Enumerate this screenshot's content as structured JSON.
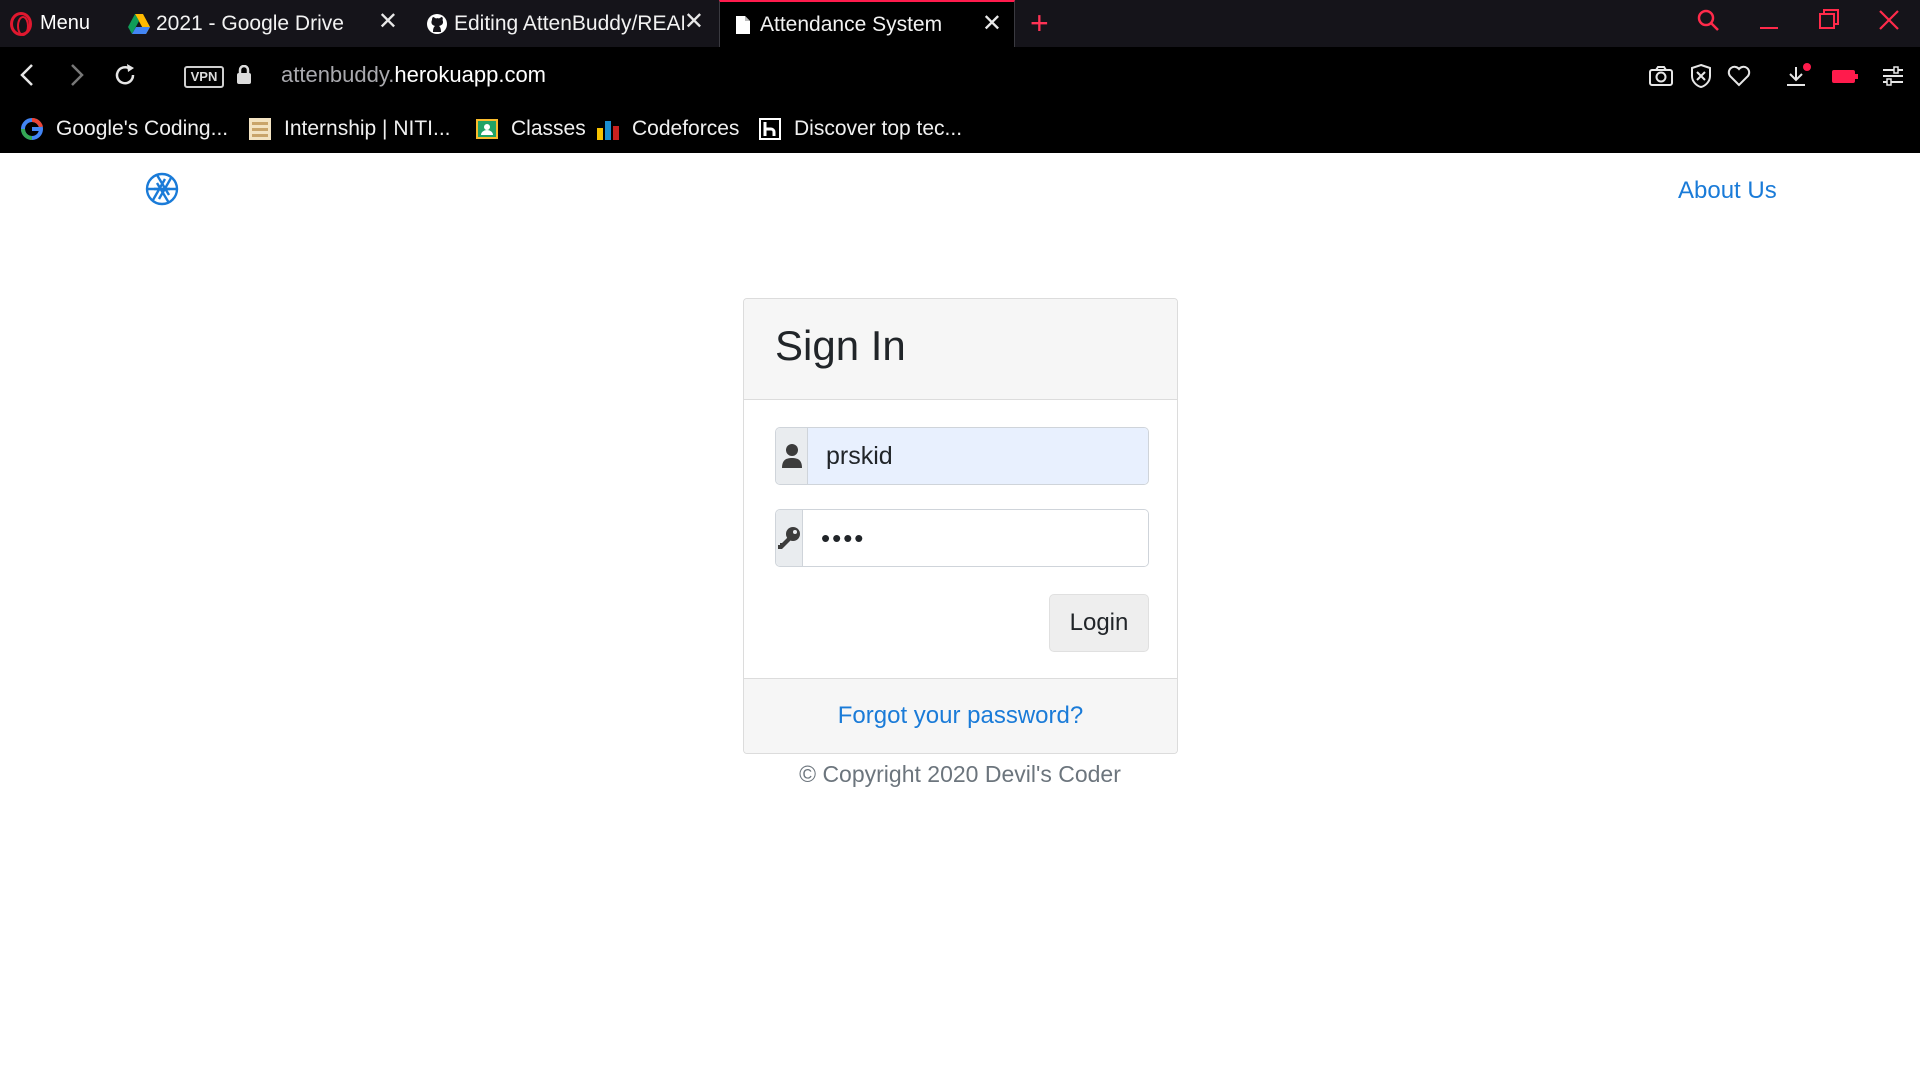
{
  "browser": {
    "menu_label": "Menu",
    "tabs": [
      {
        "title": "2021 - Google Drive",
        "icon": "google-drive-icon",
        "close": "✕"
      },
      {
        "title": "Editing AttenBuddy/READ",
        "icon": "github-icon",
        "close": "✕"
      },
      {
        "title": "Attendance System",
        "icon": "page-icon",
        "close": "✕",
        "active": true
      }
    ],
    "new_tab": "+",
    "url_prefix": "attenbuddy.",
    "url_host": "herokuapp.com",
    "vpn_label": "VPN",
    "bookmarks": [
      {
        "label": "Google's Coding...",
        "icon": "google-icon"
      },
      {
        "label": "Internship | NITI...",
        "icon": "niti-icon"
      },
      {
        "label": "Classes",
        "icon": "classroom-icon"
      },
      {
        "label": "Codeforces",
        "icon": "codeforces-icon"
      },
      {
        "label": "Discover top tec...",
        "icon": "hackerearth-icon"
      }
    ],
    "accent_color": "#ff1b4c"
  },
  "nav": {
    "about_label": "About Us"
  },
  "signin": {
    "title": "Sign In",
    "username_value": "prskid",
    "password_value": "prsk",
    "login_label": "Login",
    "forgot_label": "Forgot your password?"
  },
  "footer": {
    "copyright": "© Copyright 2020 Devil's Coder"
  },
  "colors": {
    "link": "#1a7bd8",
    "autofill": "#e8f0fe"
  }
}
